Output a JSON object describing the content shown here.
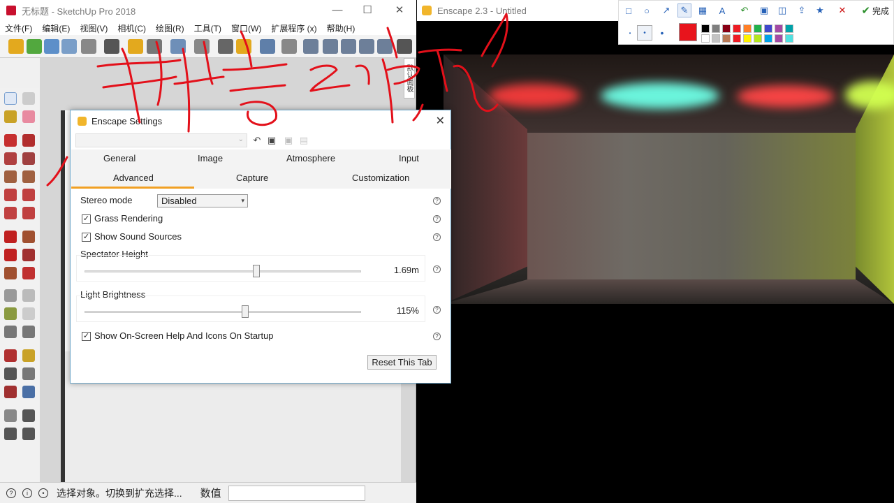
{
  "sketchup": {
    "title": "无标题 - SketchUp Pro 2018",
    "menu": [
      "文件(F)",
      "编辑(E)",
      "视图(V)",
      "相机(C)",
      "绘图(R)",
      "工具(T)",
      "窗口(W)",
      "扩展程序 (x)",
      "帮助(H)"
    ],
    "status_text": "选择对象。切换到扩充选择...",
    "vcb_label": "数值",
    "side_tab": "默认面板"
  },
  "enscape": {
    "title": "Enscape 2.3 - Untitled"
  },
  "annotation_toolbar": {
    "done_label": "完成",
    "colors": [
      "#000000",
      "#7f7f7f",
      "#880015",
      "#ed1c24",
      "#ff7f27",
      "#22b14c",
      "#3f48cc",
      "#a349a4",
      "#00a2a9",
      "#ffffff",
      "#c3c3c3",
      "#b97a57",
      "#ed1c24",
      "#fff200",
      "#b5e61d",
      "#00a2e8",
      "#a349a4",
      "#4fe0e0"
    ],
    "selected_color": "#e8141c"
  },
  "dialog": {
    "title": "Enscape Settings",
    "tabs_row1": [
      "General",
      "Image",
      "Atmosphere",
      "Input"
    ],
    "tabs_row2": [
      "Advanced",
      "Capture",
      "Customization"
    ],
    "active_tab": "Advanced",
    "stereo_mode_label": "Stereo mode",
    "stereo_mode_value": "Disabled",
    "grass_label": "Grass Rendering",
    "grass_checked": true,
    "sound_label": "Show Sound Sources",
    "sound_checked": true,
    "spectator_label": "Spectator Height",
    "spectator_value": "1.69m",
    "spectator_fraction": 0.62,
    "brightness_label": "Light Brightness",
    "brightness_value": "115%",
    "brightness_fraction": 0.58,
    "help_label": "Show On-Screen Help And Icons On Startup",
    "help_checked": true,
    "reset_label": "Reset This Tab"
  }
}
